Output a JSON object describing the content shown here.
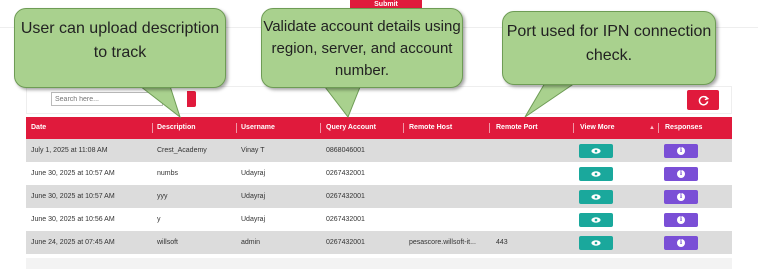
{
  "top": {
    "submit_label": "Submit"
  },
  "search": {
    "placeholder": "Search here..."
  },
  "table": {
    "headers": [
      "Date",
      "Description",
      "Username",
      "Query Account",
      "Remote Host",
      "Remote Port",
      "View More",
      "Responses"
    ],
    "rows": [
      {
        "date": "July 1, 2025 at 11:08 AM",
        "description": "Crest_Academy",
        "username": "Vinay T",
        "query_account": "0868046001",
        "remote_host": "",
        "remote_port": ""
      },
      {
        "date": "June 30, 2025 at 10:57 AM",
        "description": "numbs",
        "username": "Udayraj",
        "query_account": "0267432001",
        "remote_host": "",
        "remote_port": ""
      },
      {
        "date": "June 30, 2025 at 10:57 AM",
        "description": "yyy",
        "username": "Udayraj",
        "query_account": "0267432001",
        "remote_host": "",
        "remote_port": ""
      },
      {
        "date": "June 30, 2025 at 10:56 AM",
        "description": "y",
        "username": "Udayraj",
        "query_account": "0267432001",
        "remote_host": "",
        "remote_port": ""
      },
      {
        "date": "June 24, 2025 at 07:45 AM",
        "description": "willsoft",
        "username": "admin",
        "query_account": "0267432001",
        "remote_host": "pesascore.willsoft-it...",
        "remote_port": "443"
      }
    ]
  },
  "callouts": {
    "description": "User can upload description to track",
    "account": "Validate account details using region, server, and account number.",
    "port": "Port used for IPN connection check."
  },
  "colors": {
    "header": "#e01a3c",
    "view_button": "#1aa89c",
    "response_button": "#7a4fd6",
    "callout": "#a9d18e"
  },
  "icons": {
    "view": "eye-icon",
    "response": "info-icon",
    "refresh": "refresh-icon"
  }
}
